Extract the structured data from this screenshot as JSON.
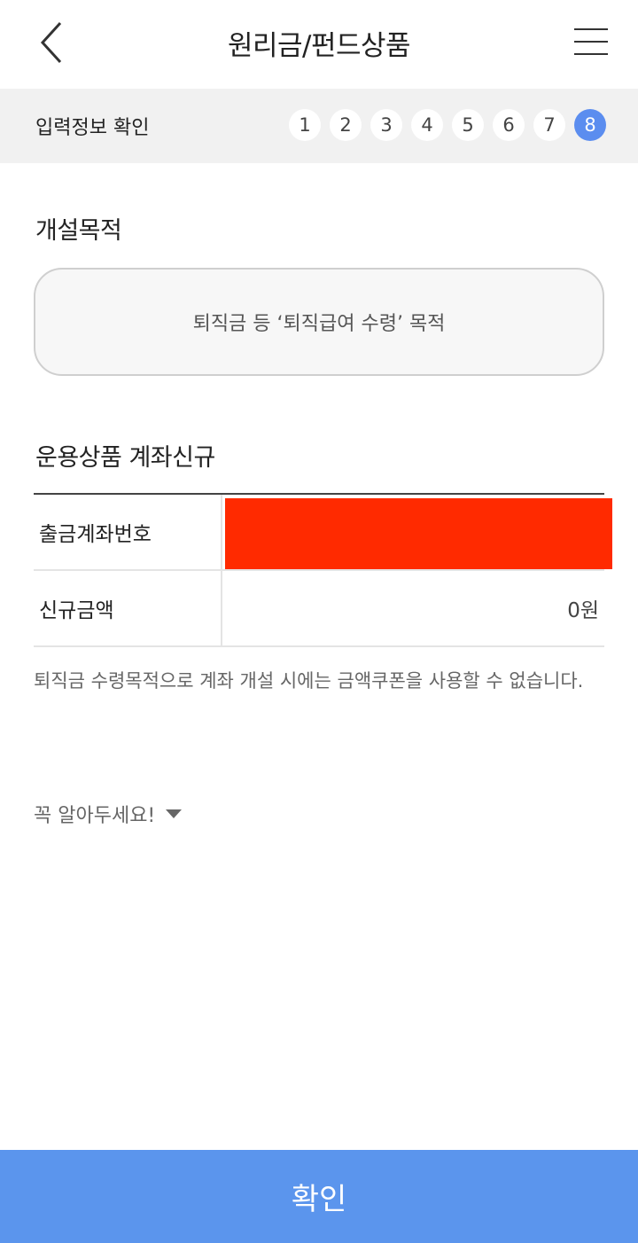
{
  "header": {
    "title": "원리금/펀드상품"
  },
  "stepbar": {
    "title": "입력정보 확인",
    "steps": [
      "1",
      "2",
      "3",
      "4",
      "5",
      "6",
      "7",
      "8"
    ],
    "active_step": "8",
    "accent_color": "#5b8def"
  },
  "purpose": {
    "section_title": "개설목적",
    "selected": "퇴직금 등 ‘퇴직급여 수령’ 목적"
  },
  "account": {
    "section_title": "운용상품 계좌신규",
    "rows": [
      {
        "label": "출금계좌번호",
        "value": ""
      },
      {
        "label": "신규금액",
        "value": "0원"
      }
    ],
    "redaction_color": "#ff2a00"
  },
  "notice": "퇴직금 수령목적으로 계좌 개설 시에는 금액쿠폰을 사용할 수 없습니다.",
  "must_know": {
    "label": "꼭 알아두세요!"
  },
  "confirm_button": {
    "label": "확인",
    "color": "#5b95ed"
  }
}
